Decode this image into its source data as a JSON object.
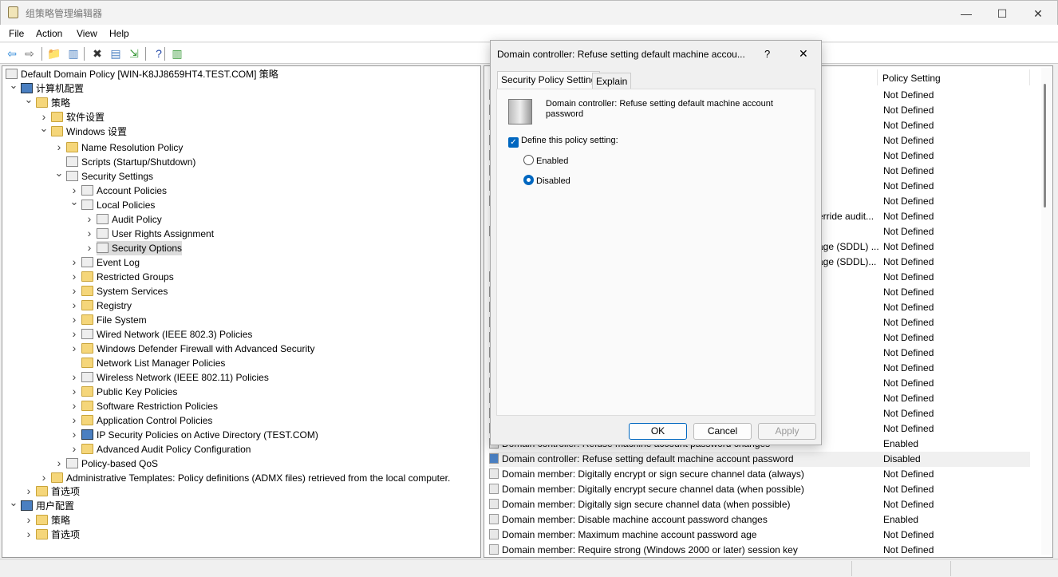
{
  "window": {
    "title": "组策略管理编辑器",
    "minimize": "—",
    "maximize": "☐",
    "close": "✕"
  },
  "menu": [
    "File",
    "Action",
    "View",
    "Help"
  ],
  "toolbar": [
    {
      "icon": "back-arrow-icon",
      "glyph": "⇦",
      "color": "#1e7fd6"
    },
    {
      "icon": "forward-arrow-icon",
      "glyph": "⇨",
      "color": "#666"
    },
    {
      "icon": "up-folder-icon",
      "glyph": "📁",
      "color": "#c9a43a"
    },
    {
      "icon": "show-hide-tree-icon",
      "glyph": "▥",
      "color": "#4a7fc1"
    },
    {
      "icon": "delete-icon",
      "glyph": "✖",
      "color": "#333"
    },
    {
      "icon": "properties-icon",
      "glyph": "▤",
      "color": "#4a7fc1"
    },
    {
      "icon": "export-list-icon",
      "glyph": "⇲",
      "color": "#3a9a3a"
    },
    {
      "icon": "help-icon",
      "glyph": "?",
      "color": "#2046a8"
    },
    {
      "icon": "show-action-pane-icon",
      "glyph": "▥",
      "color": "#3a9a3a"
    }
  ],
  "tree": [
    {
      "label": "Default Domain Policy [WIN-K8JJ8659HT4.TEST.COM] 策略",
      "level": 0,
      "chevron": "",
      "icon": "doc"
    },
    {
      "label": "计算机配置",
      "level": 0,
      "chevron": "v",
      "icon": "comp"
    },
    {
      "label": "策略",
      "level": 1,
      "chevron": "v",
      "icon": "folder"
    },
    {
      "label": "软件设置",
      "level": 2,
      "chevron": ">",
      "icon": "folder"
    },
    {
      "label": "Windows 设置",
      "level": 2,
      "chevron": "v",
      "icon": "folder"
    },
    {
      "label": "Name Resolution Policy",
      "level": 3,
      "chevron": ">",
      "icon": "folder"
    },
    {
      "label": "Scripts (Startup/Shutdown)",
      "level": 3,
      "chevron": "",
      "icon": "doc"
    },
    {
      "label": "Security Settings",
      "level": 3,
      "chevron": "v",
      "icon": "doc"
    },
    {
      "label": "Account Policies",
      "level": 4,
      "chevron": ">",
      "icon": "doc"
    },
    {
      "label": "Local Policies",
      "level": 4,
      "chevron": "v",
      "icon": "doc"
    },
    {
      "label": "Audit Policy",
      "level": 5,
      "chevron": ">",
      "icon": "doc"
    },
    {
      "label": "User Rights Assignment",
      "level": 5,
      "chevron": ">",
      "icon": "doc"
    },
    {
      "label": "Security Options",
      "level": 5,
      "chevron": ">",
      "icon": "doc",
      "selected": true
    },
    {
      "label": "Event Log",
      "level": 4,
      "chevron": ">",
      "icon": "doc"
    },
    {
      "label": "Restricted Groups",
      "level": 4,
      "chevron": ">",
      "icon": "folder"
    },
    {
      "label": "System Services",
      "level": 4,
      "chevron": ">",
      "icon": "folder"
    },
    {
      "label": "Registry",
      "level": 4,
      "chevron": ">",
      "icon": "folder"
    },
    {
      "label": "File System",
      "level": 4,
      "chevron": ">",
      "icon": "folder"
    },
    {
      "label": "Wired Network (IEEE 802.3) Policies",
      "level": 4,
      "chevron": ">",
      "icon": "doc"
    },
    {
      "label": "Windows Defender Firewall with Advanced Security",
      "level": 4,
      "chevron": ">",
      "icon": "folder"
    },
    {
      "label": "Network List Manager Policies",
      "level": 4,
      "chevron": "",
      "icon": "folder"
    },
    {
      "label": "Wireless Network (IEEE 802.11) Policies",
      "level": 4,
      "chevron": ">",
      "icon": "doc"
    },
    {
      "label": "Public Key Policies",
      "level": 4,
      "chevron": ">",
      "icon": "folder"
    },
    {
      "label": "Software Restriction Policies",
      "level": 4,
      "chevron": ">",
      "icon": "folder"
    },
    {
      "label": "Application Control Policies",
      "level": 4,
      "chevron": ">",
      "icon": "folder"
    },
    {
      "label": "IP Security Policies on Active Directory (TEST.COM)",
      "level": 4,
      "chevron": ">",
      "icon": "comp"
    },
    {
      "label": "Advanced Audit Policy Configuration",
      "level": 4,
      "chevron": ">",
      "icon": "folder"
    },
    {
      "label": "Policy-based QoS",
      "level": 3,
      "chevron": ">",
      "icon": "doc"
    },
    {
      "label": "Administrative Templates: Policy definitions (ADMX files) retrieved from the local computer.",
      "level": 2,
      "chevron": ">",
      "icon": "folder"
    },
    {
      "label": "首选项",
      "level": 1,
      "chevron": ">",
      "icon": "folder"
    },
    {
      "label": "用户配置",
      "level": 0,
      "chevron": "v",
      "icon": "comp"
    },
    {
      "label": "策略",
      "level": 1,
      "chevron": ">",
      "icon": "folder"
    },
    {
      "label": "首选项",
      "level": 1,
      "chevron": ">",
      "icon": "folder"
    }
  ],
  "list": {
    "header_setting": "Policy Setting",
    "rows": [
      {
        "name": "",
        "value": "Not Defined"
      },
      {
        "name": "",
        "value": "Not Defined"
      },
      {
        "name": "",
        "value": "Not Defined"
      },
      {
        "name": "",
        "value": "Not Defined"
      },
      {
        "name": "",
        "value": "Not Defined"
      },
      {
        "name": "",
        "value": "Not Defined"
      },
      {
        "name": "",
        "value": "Not Defined"
      },
      {
        "name": "",
        "value": "Not Defined"
      },
      {
        "name": "erride audit...",
        "value": "Not Defined"
      },
      {
        "name": "",
        "value": "Not Defined"
      },
      {
        "name": "age (SDDL) ...",
        "value": "Not Defined"
      },
      {
        "name": "age (SDDL)...",
        "value": "Not Defined"
      },
      {
        "name": "",
        "value": "Not Defined"
      },
      {
        "name": "",
        "value": "Not Defined"
      },
      {
        "name": "",
        "value": "Not Defined"
      },
      {
        "name": "",
        "value": "Not Defined"
      },
      {
        "name": "",
        "value": "Not Defined"
      },
      {
        "name": "",
        "value": "Not Defined"
      },
      {
        "name": "",
        "value": "Not Defined"
      },
      {
        "name": "",
        "value": "Not Defined"
      },
      {
        "name": "",
        "value": "Not Defined"
      },
      {
        "name": "",
        "value": "Not Defined"
      },
      {
        "name": "",
        "value": "Not Defined"
      },
      {
        "name": "Domain controller: Refuse machine account password changes",
        "value": "Enabled"
      },
      {
        "name": "Domain controller: Refuse setting default machine account password",
        "value": "Disabled",
        "selected": true
      },
      {
        "name": "Domain member: Digitally encrypt or sign secure channel data (always)",
        "value": "Not Defined"
      },
      {
        "name": "Domain member: Digitally encrypt secure channel data (when possible)",
        "value": "Not Defined"
      },
      {
        "name": "Domain member: Digitally sign secure channel data (when possible)",
        "value": "Not Defined"
      },
      {
        "name": "Domain member: Disable machine account password changes",
        "value": "Enabled"
      },
      {
        "name": "Domain member: Maximum machine account password age",
        "value": "Not Defined"
      },
      {
        "name": "Domain member: Require strong (Windows 2000 or later) session key",
        "value": "Not Defined"
      }
    ]
  },
  "dialog": {
    "title": "Domain controller: Refuse setting default machine accou...",
    "help": "?",
    "close": "✕",
    "tabs": [
      "Security Policy Setting",
      "Explain"
    ],
    "policy_name": "Domain controller: Refuse setting default machine account password",
    "define_label": "Define this policy setting:",
    "define_checked": true,
    "check_glyph": "✓",
    "enabled_label": "Enabled",
    "disabled_label": "Disabled",
    "selected_option": "Disabled",
    "ok": "OK",
    "cancel": "Cancel",
    "apply": "Apply"
  }
}
